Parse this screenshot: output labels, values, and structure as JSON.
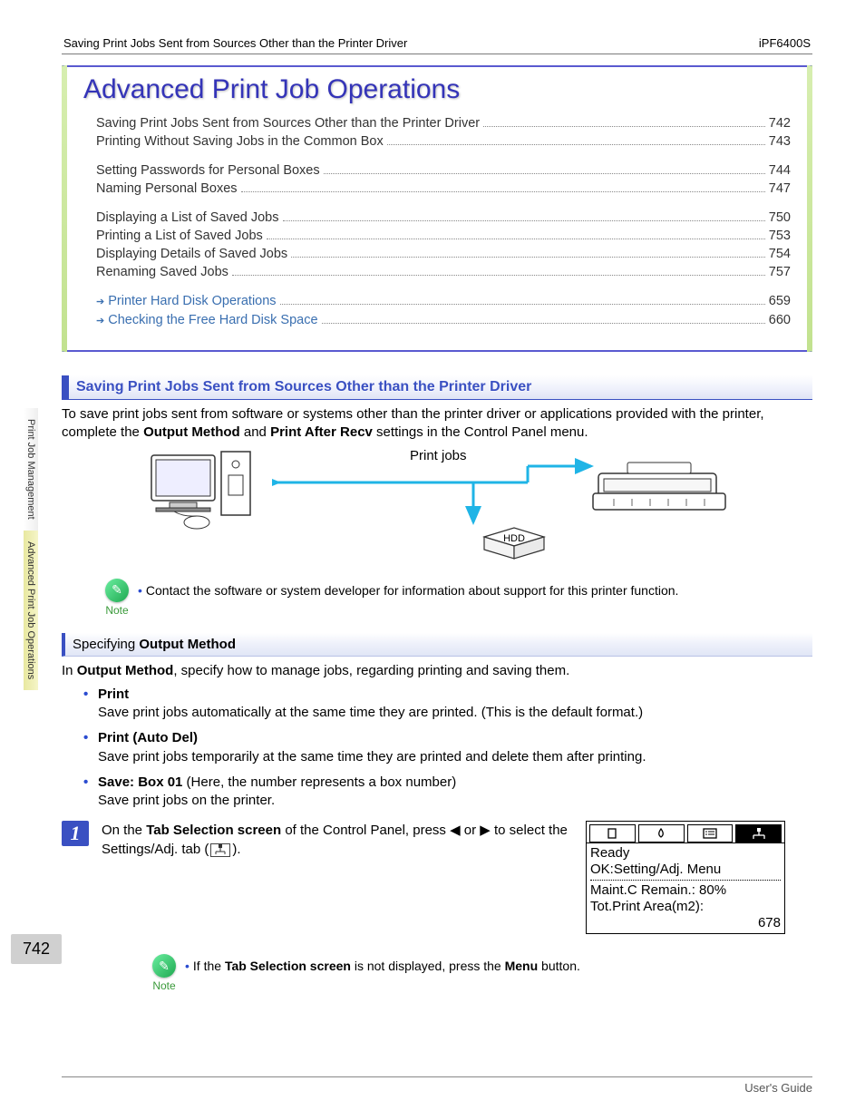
{
  "header": {
    "breadcrumb": "Saving Print Jobs Sent from Sources Other than the Printer Driver",
    "model": "iPF6400S"
  },
  "title": "Advanced Print Job Operations",
  "toc": {
    "group1": [
      {
        "label": "Saving Print Jobs Sent from Sources Other than the Printer Driver",
        "page": "742"
      },
      {
        "label": "Printing Without Saving Jobs in the Common Box",
        "page": "743"
      }
    ],
    "group2": [
      {
        "label": "Setting Passwords for Personal Boxes",
        "page": "744"
      },
      {
        "label": "Naming Personal Boxes",
        "page": "747"
      }
    ],
    "group3": [
      {
        "label": "Displaying a List of Saved Jobs",
        "page": "750"
      },
      {
        "label": "Printing a List of Saved Jobs",
        "page": "753"
      },
      {
        "label": "Displaying Details of Saved Jobs",
        "page": "754"
      },
      {
        "label": "Renaming Saved Jobs",
        "page": "757"
      }
    ],
    "group4": [
      {
        "label": "Printer Hard Disk Operations",
        "page": "659",
        "ref": true
      },
      {
        "label": "Checking the Free Hard Disk Space",
        "page": "660",
        "ref": true
      }
    ]
  },
  "section": {
    "heading": "Saving Print Jobs Sent from Sources Other than the Printer Driver",
    "intro_pre": "To save print jobs sent from software or systems other than the printer driver or applications provided with the printer, complete the ",
    "intro_b1": "Output Method",
    "intro_mid": " and ",
    "intro_b2": "Print After Recv",
    "intro_post": " settings in the Control Panel menu."
  },
  "diagram": {
    "jobs_label": "Print jobs",
    "hdd_label": "HDD"
  },
  "note1": {
    "label": "Note",
    "text": "Contact the software or system developer for information about support for this printer function."
  },
  "subhead": {
    "plain": "Specifying ",
    "bold": "Output Method"
  },
  "om_intro_pre": "In ",
  "om_intro_b": "Output Method",
  "om_intro_post": ", specify how to manage jobs, regarding printing and saving them.",
  "bullets": [
    {
      "lead": "Print",
      "detail": "Save print jobs automatically at the same time they are printed. (This is the default format.)"
    },
    {
      "lead": "Print (Auto Del)",
      "detail": "Save print jobs temporarily at the same time they are printed and delete them after printing."
    },
    {
      "lead": "Save: Box 01",
      "lead_post": " (Here, the number represents a box number)",
      "detail": "Save print jobs on the printer."
    }
  ],
  "step1": {
    "num": "1",
    "pre": "On the ",
    "b1": "Tab Selection screen",
    "mid": " of the Control Panel, press ◀ or ▶ to select the Settings/Adj. tab (",
    "post": ")."
  },
  "lcd": {
    "line1": "Ready",
    "line2": "OK:Setting/Adj. Menu",
    "line3": "Maint.C Remain.: 80%",
    "line4": "Tot.Print Area(m2):",
    "line5": "678"
  },
  "note2": {
    "label": "Note",
    "pre": "If the ",
    "b1": "Tab Selection screen",
    "mid": " is not displayed, press the ",
    "b2": "Menu",
    "post": " button."
  },
  "side": {
    "tab1": "Print Job Management",
    "tab2": "Advanced Print Job Operations"
  },
  "page_number": "742",
  "footer": "User's Guide"
}
